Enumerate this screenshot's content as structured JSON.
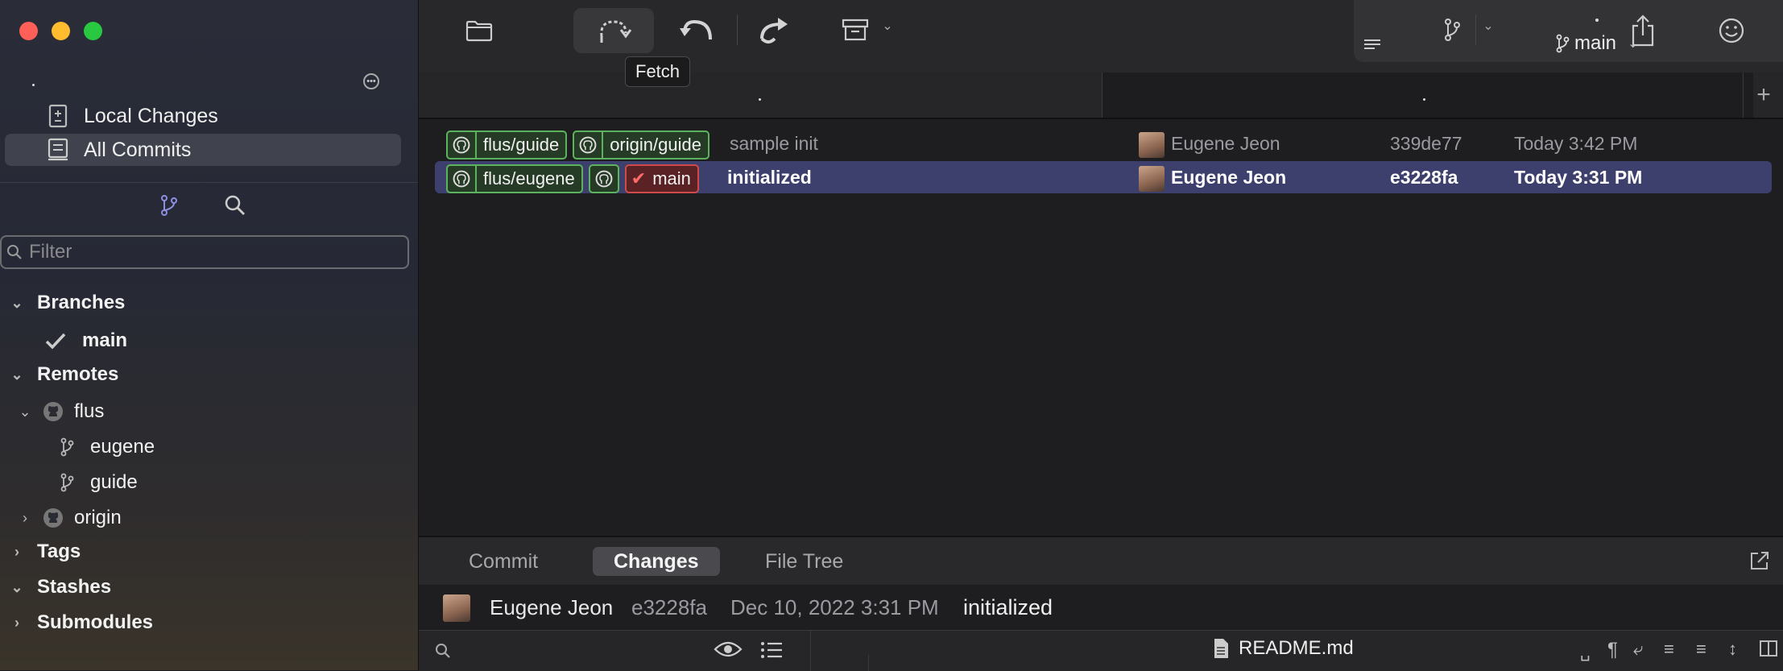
{
  "sidebar": {
    "nav": [
      {
        "label": "Local Changes",
        "icon": "local-changes-icon"
      },
      {
        "label": "All Commits",
        "icon": "all-commits-icon",
        "selected": true
      }
    ],
    "filter_placeholder": "Filter",
    "sections": {
      "branches": "Branches",
      "branch_current": "main",
      "remotes": "Remotes",
      "remote_flus": "flus",
      "remote_flus_branches": [
        "eugene",
        "guide"
      ],
      "remote_origin": "origin",
      "tags": "Tags",
      "stashes": "Stashes",
      "submodules": "Submodules"
    }
  },
  "toolbar": {
    "tooltip": "Fetch",
    "branch": "main"
  },
  "commits": [
    {
      "refs": [
        {
          "kind": "remote",
          "label": "flus/guide"
        },
        {
          "kind": "remote",
          "label": "origin/guide"
        }
      ],
      "message": "sample init",
      "author": "Eugene Jeon",
      "hash": "339de77",
      "date": "Today 3:42 PM"
    },
    {
      "refs": [
        {
          "kind": "remote",
          "label": "flus/eugene"
        },
        {
          "kind": "remote",
          "label": ""
        },
        {
          "kind": "local",
          "label": "main"
        }
      ],
      "message": "initialized",
      "author": "Eugene Jeon",
      "hash": "e3228fa",
      "date": "Today 3:31 PM",
      "selected": true
    }
  ],
  "detail": {
    "tabs": [
      "Commit",
      "Changes",
      "File Tree"
    ],
    "active_tab": "Changes",
    "author": "Eugene Jeon",
    "hash": "e3228fa",
    "date": "Dec 10, 2022 3:31 PM",
    "message": "initialized",
    "file": "README.md"
  },
  "colors": {
    "remote_ref": "#5db35d",
    "local_ref": "#d04a4a",
    "selection": "#3d3f6c"
  }
}
